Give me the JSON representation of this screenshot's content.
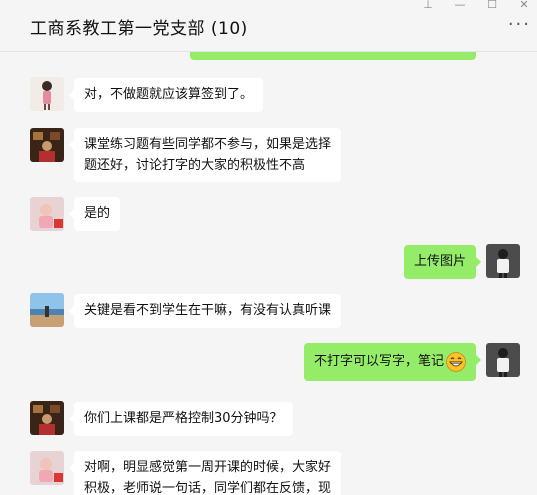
{
  "window": {
    "title": "工商系教工第一党支部 (10)",
    "controls": {
      "pin": "⊥",
      "minimize": "—",
      "maximize": "☐",
      "close": "✕"
    },
    "more": "···"
  },
  "messages": [
    {
      "side": "other",
      "text": "对，不做题就应该算签到了。",
      "avatar": "avatar-pink-girl"
    },
    {
      "side": "other",
      "lines": [
        "课堂练习题有些同学都不参与，如果是选择",
        "题还好，讨论打字的大家的积极性不高"
      ],
      "avatar": "avatar-dark-room"
    },
    {
      "side": "other",
      "text": "是的",
      "avatar": "avatar-child-flag"
    },
    {
      "side": "me",
      "text": "上传图片",
      "avatar": "avatar-man-white"
    },
    {
      "side": "other",
      "text": "关键是看不到学生在干嘛，有没有认真听课",
      "avatar": "avatar-beach"
    },
    {
      "side": "me",
      "text": "不打字可以写字，笔记",
      "emoji": "grin-emoji",
      "avatar": "avatar-man-white"
    },
    {
      "side": "other",
      "text": "你们上课都是严格控制30分钟吗？",
      "avatar": "avatar-dark-room"
    },
    {
      "side": "other",
      "lines": [
        "对啊，明显感觉第一周开课的时候，大家好",
        "积极，老师说一句话，同学们都在反馈，现"
      ],
      "avatar": "avatar-child-flag"
    }
  ],
  "colors": {
    "my_bubble": "#95ec69",
    "other_bubble": "#ffffff",
    "background": "#f5f5f5"
  }
}
